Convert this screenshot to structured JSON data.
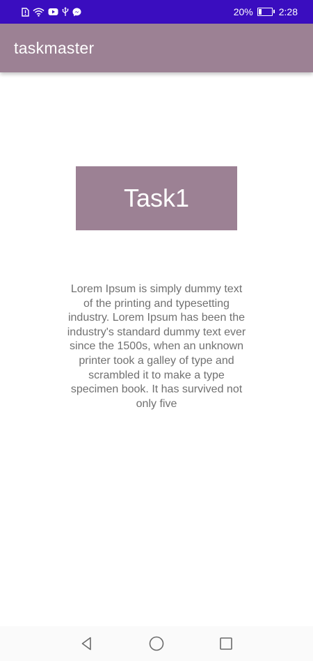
{
  "status_bar": {
    "battery_percent": "20%",
    "time": "2:28",
    "battery_level": 0.2,
    "left_icons": [
      "sim-alert-icon",
      "wifi-icon",
      "youtube-icon",
      "usb-icon",
      "messenger-icon"
    ]
  },
  "app_bar": {
    "title": "taskmaster"
  },
  "main": {
    "task_button_label": "Task1",
    "description": "Lorem Ipsum is simply dummy text of the printing and typesetting industry. Lorem Ipsum has been the industry's standard dummy text ever since the 1500s, when an unknown printer took a galley of type and scrambled it to make a type specimen book. It has survived not only five"
  },
  "nav_bar": {
    "icons": [
      "back-icon",
      "home-icon",
      "recents-icon"
    ]
  },
  "colors": {
    "status_bar": "#3a0dbf",
    "app_bar": "#9c8194",
    "button": "#9c8194",
    "text": "#707070",
    "nav_bar": "#fafafa"
  }
}
